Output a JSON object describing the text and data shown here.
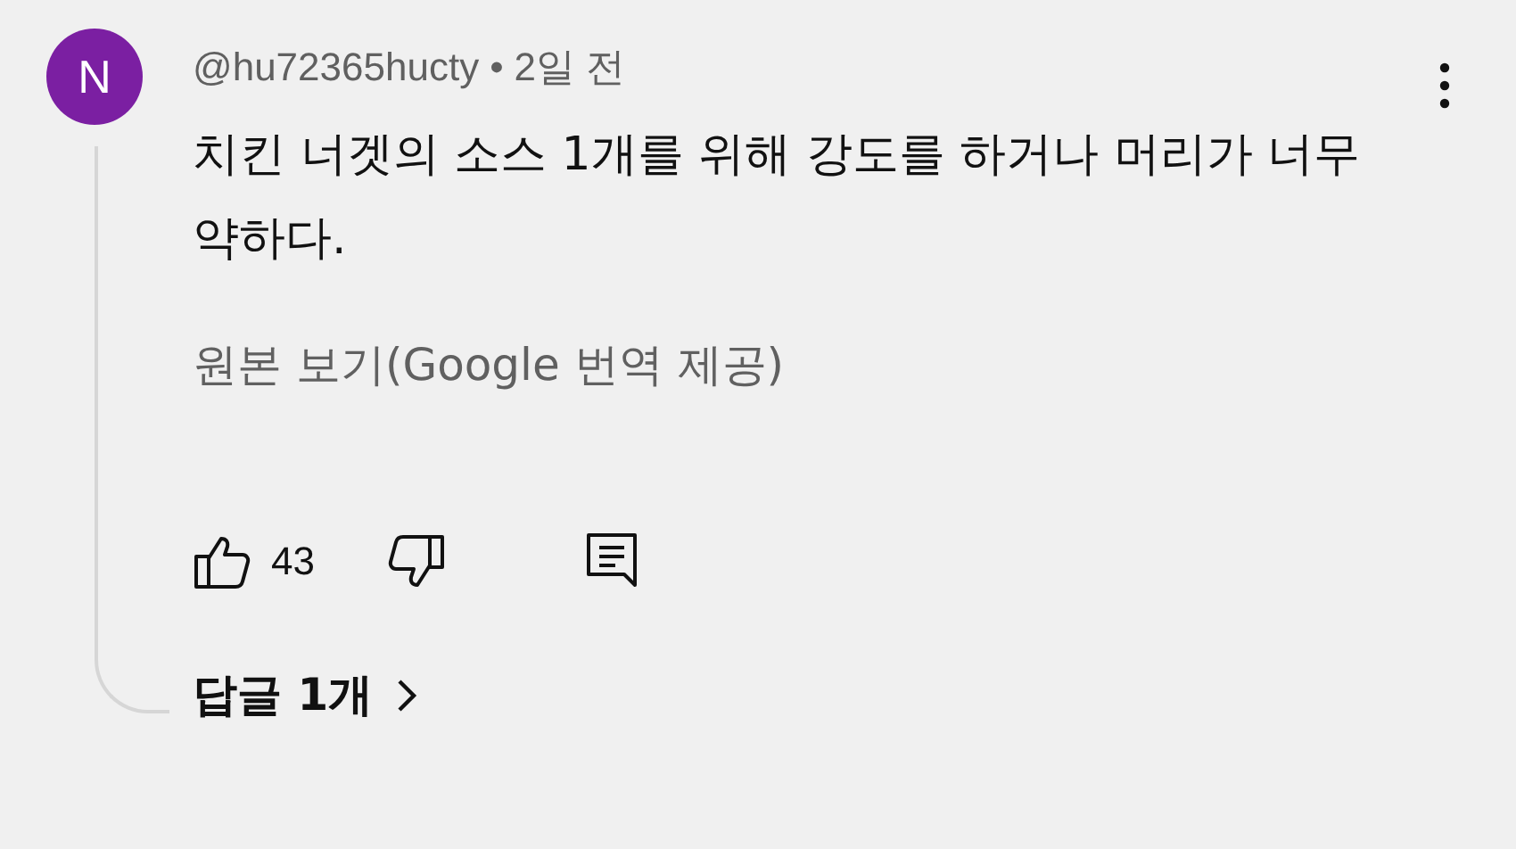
{
  "comment": {
    "avatar_letter": "N",
    "author": "@hu72365hucty",
    "separator": "•",
    "time": "2일 전",
    "text": "치킨 너겟의 소스 1개를 위해 강도를 하거나 머리가 너무 약하다.",
    "translation_link": "원본 보기(Google 번역 제공)",
    "like_count": "43",
    "replies_label": "답글 1개"
  }
}
